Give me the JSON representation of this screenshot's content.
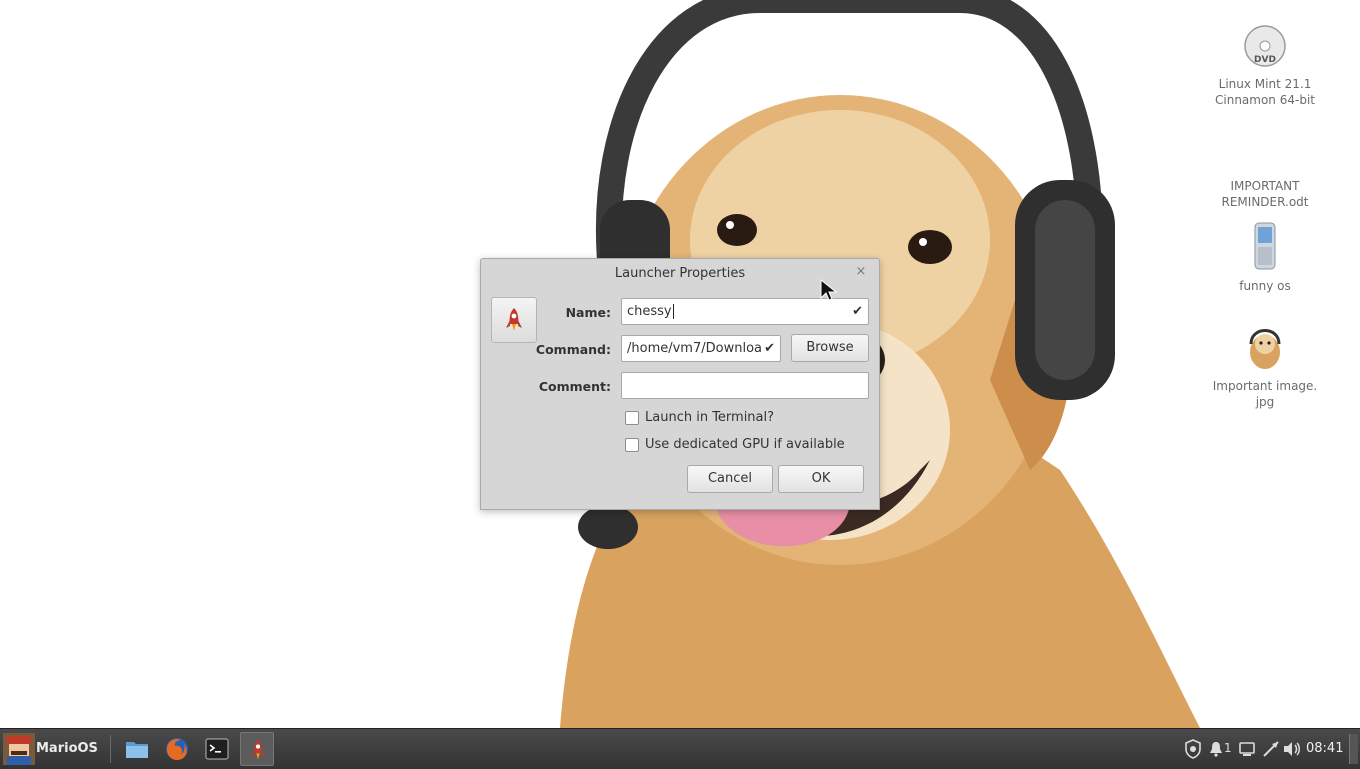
{
  "desktop": {
    "icons": [
      {
        "label": "Linux Mint 21.1\nCinnamon 64-bit",
        "icon": "dvd-icon"
      },
      {
        "label": "IMPORTANT\nREMINDER.odt",
        "icon": "document-icon"
      },
      {
        "label": "funny os",
        "icon": "phone-icon"
      },
      {
        "label": "Important image.\njpg",
        "icon": "image-icon"
      }
    ]
  },
  "dialog": {
    "title": "Launcher Properties",
    "close_label": "×",
    "fields": {
      "name_label": "Name:",
      "name_value": "chessy",
      "command_label": "Command:",
      "command_value": "/home/vm7/Downloa",
      "comment_label": "Comment:",
      "comment_value": ""
    },
    "browse_label": "Browse",
    "check_mark": "✔",
    "checkboxes": [
      {
        "label": "Launch in Terminal?",
        "checked": false
      },
      {
        "label": "Use dedicated GPU if available",
        "checked": false
      }
    ],
    "cancel_label": "Cancel",
    "ok_label": "OK"
  },
  "taskbar": {
    "menu_label": "MarioOS",
    "apps": [
      "file-manager-icon",
      "firefox-icon",
      "terminal-icon",
      "launcher-rocket-icon"
    ],
    "notification_count": "1",
    "clock": "08:41"
  },
  "colors": {
    "dialog_bg": "#d6d6d6",
    "taskbar_bg": "#3a3a3a",
    "rocket_red": "#c0392b"
  }
}
